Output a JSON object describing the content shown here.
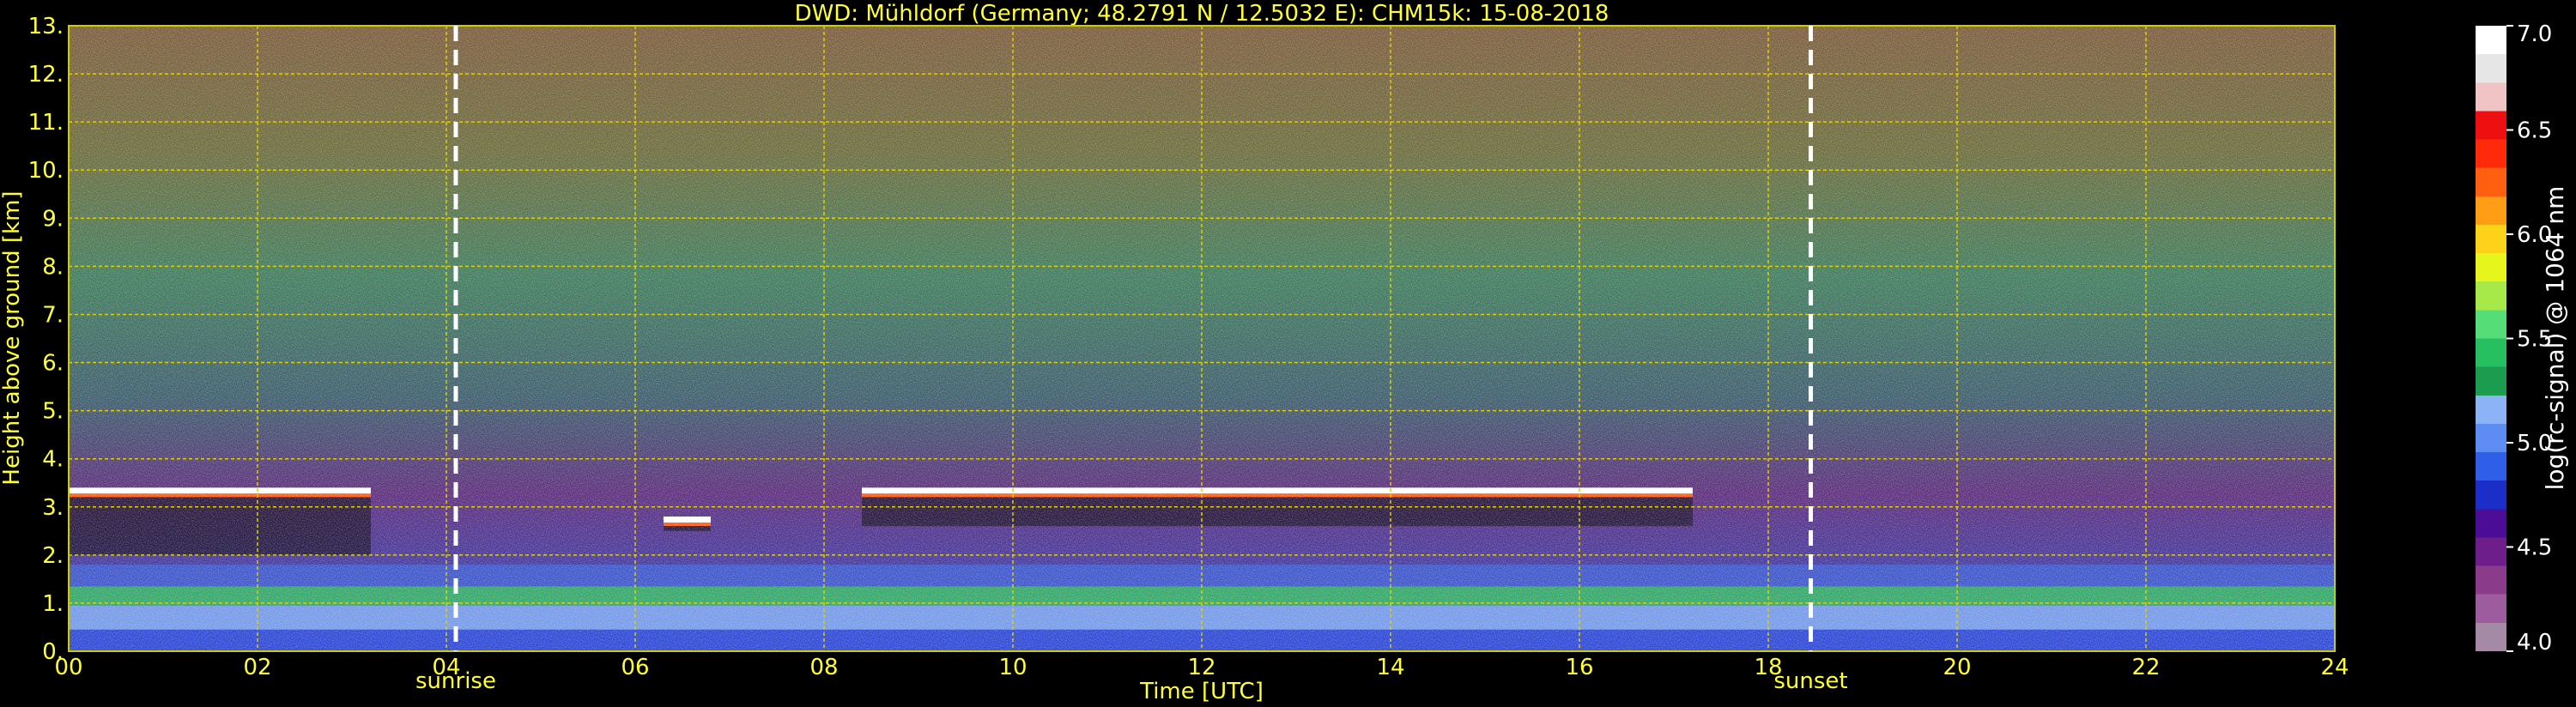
{
  "chart_data": {
    "type": "heatmap",
    "title": "DWD: Mühldorf (Germany; 48.2791 N / 12.5032 E):    CHM15k: 15-08-2018",
    "xlabel": "Time [UTC]",
    "ylabel": "Height above ground [km]",
    "xlim": [
      0,
      24
    ],
    "ylim": [
      0,
      13
    ],
    "x_ticks": [
      "00",
      "02",
      "04",
      "06",
      "08",
      "10",
      "12",
      "14",
      "16",
      "18",
      "20",
      "22",
      "24"
    ],
    "y_ticks": [
      "0.",
      "1.",
      "2.",
      "3.",
      "4.",
      "5.",
      "6.",
      "7.",
      "8.",
      "9.",
      "10.",
      "11.",
      "12.",
      "13."
    ],
    "grid": true,
    "events": [
      {
        "label": "sunrise",
        "time": 4.1
      },
      {
        "label": "sunset",
        "time": 18.45
      }
    ],
    "colorbar": {
      "label": "log(rc-signal) @ 1064 nm",
      "range": [
        4.0,
        7.0
      ],
      "ticks": [
        "4.0",
        "4.5",
        "5.0",
        "5.5",
        "6.0",
        "6.5",
        "7.0"
      ],
      "colors": [
        "#a58aa5",
        "#9d5c9d",
        "#8a3c8a",
        "#6e1e8a",
        "#4b0d96",
        "#1c2ec8",
        "#2f5fe8",
        "#5d8cf2",
        "#8cb3f5",
        "#1b9c4e",
        "#27c060",
        "#55dd77",
        "#a8e94a",
        "#e6f51c",
        "#ffd21a",
        "#ff9d15",
        "#ff6010",
        "#ff2a0a",
        "#ee1010",
        "#f0c4c4",
        "#e6e6e6",
        "#ffffff"
      ]
    },
    "features": [
      {
        "name": "boundary layer (strong signal)",
        "x": [
          0,
          24
        ],
        "y": [
          0,
          1.8
        ]
      },
      {
        "name": "cloud layer",
        "x": [
          0,
          3.2
        ],
        "y": [
          2.0,
          3.4
        ]
      },
      {
        "name": "cloud layer",
        "x": [
          6.3,
          6.8
        ],
        "y": [
          2.5,
          2.8
        ]
      },
      {
        "name": "cloud layer",
        "x": [
          8.4,
          17.2
        ],
        "y": [
          2.6,
          3.4
        ]
      }
    ]
  }
}
